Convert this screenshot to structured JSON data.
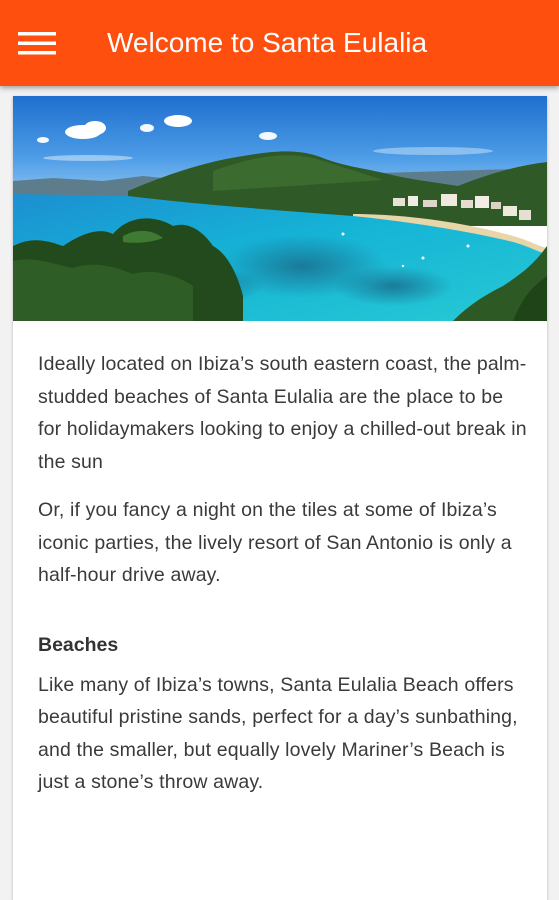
{
  "app_bar": {
    "title": "Welcome to Santa Eulalia",
    "background_color": "#ff4f0f",
    "menu_icon": "hamburger-menu-icon"
  },
  "hero_image": {
    "depicts": "bay-coastline-photo"
  },
  "content": {
    "paragraph_1": "Ideally located on Ibiza’s south eastern coast, the palm-studded beaches of Santa Eulalia are the place to be for holidaymakers looking to enjoy a chilled-out break in the sun",
    "paragraph_2": "Or, if you fancy a night on the tiles at some of Ibiza’s iconic parties, the lively resort of San Antonio is only a half-hour drive away.",
    "section_heading": "Beaches",
    "paragraph_3": "Like many of Ibiza’s towns, Santa Eulalia Beach offers beautiful pristine sands, perfect for a day’s sunbathing, and the smaller, but equally lovely Mariner’s Beach is just a stone’s throw away."
  }
}
